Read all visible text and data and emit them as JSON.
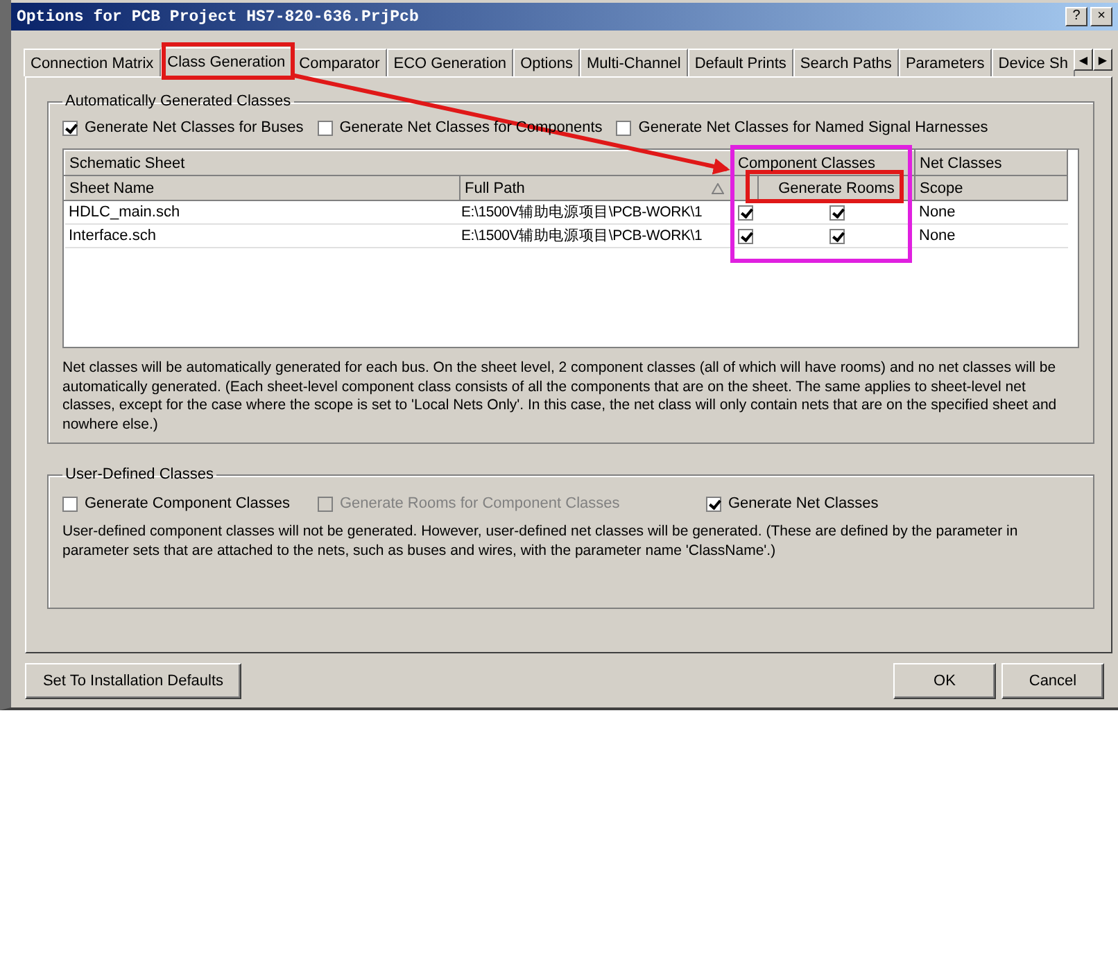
{
  "window": {
    "title": "Options for PCB Project HS7-820-636.PrjPcb",
    "buttons": [
      "?",
      "×"
    ]
  },
  "tabs": [
    {
      "label": "Connection Matrix",
      "selected": false
    },
    {
      "label": "Class Generation",
      "selected": true
    },
    {
      "label": "Comparator",
      "selected": false
    },
    {
      "label": "ECO Generation",
      "selected": false
    },
    {
      "label": "Options",
      "selected": false
    },
    {
      "label": "Multi-Channel",
      "selected": false
    },
    {
      "label": "Default Prints",
      "selected": false
    },
    {
      "label": "Search Paths",
      "selected": false
    },
    {
      "label": "Parameters",
      "selected": false
    },
    {
      "label": "Device Sh",
      "selected": false
    }
  ],
  "tab_scroll": [
    "◀",
    "▶"
  ],
  "auto_group": {
    "title": "Automatically Generated Classes",
    "options": [
      {
        "label": "Generate Net Classes for Buses",
        "checked": true
      },
      {
        "label": "Generate Net Classes for Components",
        "checked": false
      },
      {
        "label": "Generate Net Classes for Named Signal Harnesses",
        "checked": false
      }
    ],
    "table": {
      "group_headers": [
        "Schematic Sheet",
        "Component Classes",
        "Net Classes"
      ],
      "columns": [
        {
          "label": "Sheet Name",
          "sorted": false
        },
        {
          "label": "Full Path",
          "sorted": true
        },
        {
          "label": "Generate Rooms",
          "sorted": false
        },
        {
          "label": "Scope",
          "sorted": false
        }
      ],
      "rows": [
        {
          "sheet_name": "HDLC_main.sch",
          "full_path": "E:\\1500V辅助电源项目\\PCB-WORK\\1",
          "component_class": true,
          "generate_rooms": true,
          "scope": "None"
        },
        {
          "sheet_name": "Interface.sch",
          "full_path": "E:\\1500V辅助电源项目\\PCB-WORK\\1",
          "component_class": true,
          "generate_rooms": true,
          "scope": "None"
        }
      ]
    },
    "description": "Net classes will be automatically generated for each bus. On the sheet level, 2 component classes (all of which will have rooms) and no net classes will be automatically generated. (Each sheet-level component class consists of all the components that are on the sheet. The same applies to sheet-level net classes, except for the case where the scope is set to 'Local Nets Only'. In this case, the net class will only contain nets that are on the specified sheet and nowhere else.)"
  },
  "user_group": {
    "title": "User-Defined Classes",
    "options": [
      {
        "label": "Generate Component Classes",
        "checked": false,
        "disabled": false
      },
      {
        "label": "Generate Rooms for Component Classes",
        "checked": false,
        "disabled": true
      },
      {
        "label": "Generate Net Classes",
        "checked": true,
        "disabled": false
      }
    ],
    "description": "User-defined component classes will not be generated. However, user-defined net classes will be generated. (These are defined by the parameter in parameter sets that are attached to the nets, such as buses and wires, with the parameter name 'ClassName'.)"
  },
  "defaults_button": "Set To Installation Defaults",
  "buttons": [
    "OK",
    "Cancel"
  ],
  "annotations": [
    {
      "kind": "tab-outline",
      "color": "#e01818"
    },
    {
      "kind": "header-outline",
      "color": "#e01818"
    },
    {
      "kind": "column-outline",
      "color": "#e020e0"
    },
    {
      "kind": "arrow",
      "color": "#e01818"
    }
  ]
}
